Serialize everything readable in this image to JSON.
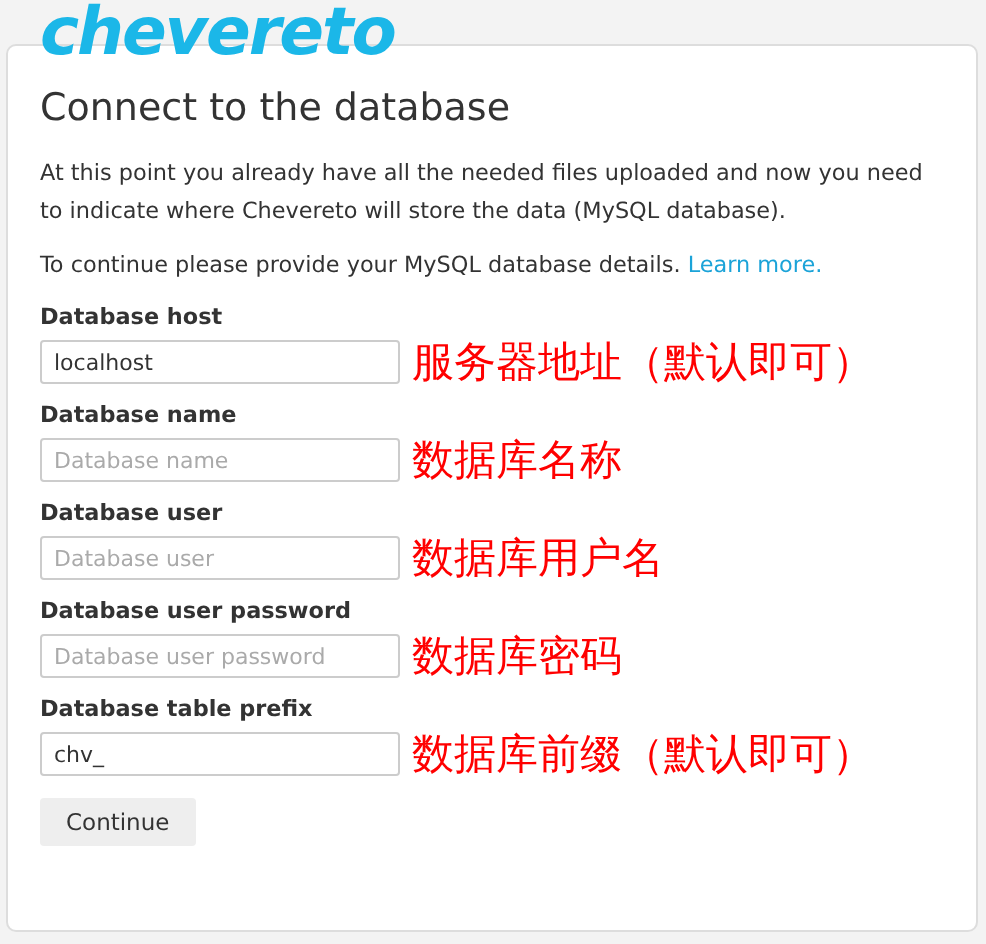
{
  "logo": "chevereto",
  "title": "Connect to the database",
  "intro": "At this point you already have all the needed files uploaded and now you need to indicate where Chevereto will store the data (MySQL database).",
  "details": {
    "text": "To continue please provide your MySQL database details.",
    "link": "Learn more."
  },
  "fields": [
    {
      "label": "Database host",
      "value": "localhost",
      "annotation": "服务器地址（默认即可）"
    },
    {
      "label": "Database name",
      "placeholder": "Database name",
      "annotation": "数据库名称"
    },
    {
      "label": "Database user",
      "placeholder": "Database user",
      "annotation": "数据库用户名"
    },
    {
      "label": "Database user password",
      "placeholder": "Database user password",
      "annotation": "数据库密码"
    },
    {
      "label": "Database table prefix",
      "value": "chv_",
      "annotation": "数据库前缀（默认即可）"
    }
  ],
  "button": "Continue"
}
